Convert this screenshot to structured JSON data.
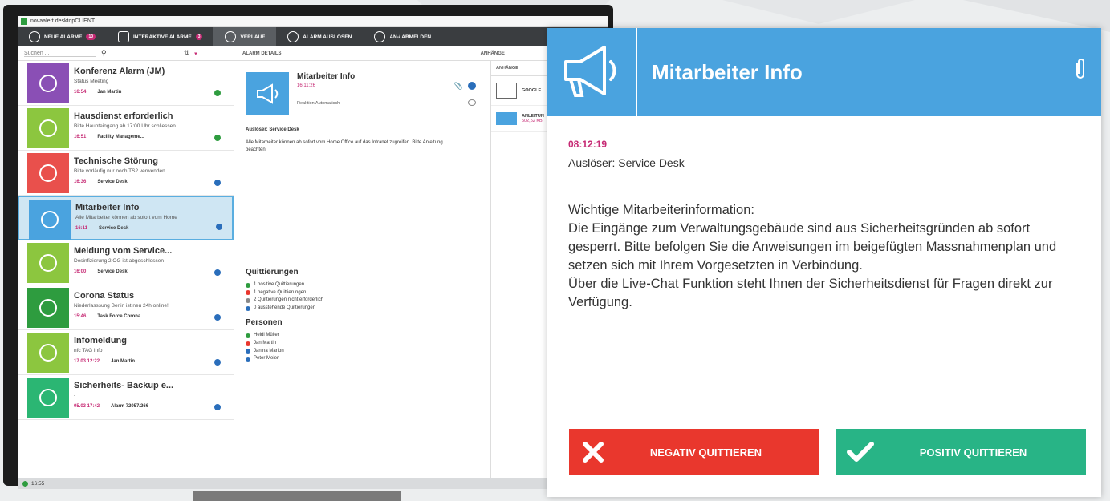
{
  "app": {
    "title": "novaalert desktopCLIENT"
  },
  "tabs": [
    {
      "label": "NEUE ALARME",
      "badge": "10"
    },
    {
      "label": "INTERAKTIVE ALARME",
      "badge": "3"
    },
    {
      "label": "VERLAUF"
    },
    {
      "label": "ALARM AUSLÖSEN"
    },
    {
      "label": "AN-/ ABMELDEN"
    }
  ],
  "search": {
    "placeholder": "Suchen ..."
  },
  "sections": {
    "details": "ALARM DETAILS",
    "attachments": "ANHÄNGE"
  },
  "alarms": [
    {
      "title": "Konferenz Alarm (JM)",
      "sub": "Status Meeting",
      "time": "16:54",
      "who": "Jan Martin",
      "color": "#8a4fb5",
      "status": "#2e9c3f"
    },
    {
      "title": "Hausdienst erforderlich",
      "sub": "Bitte Haupteingang ab 17:00 Uhr schliessen.",
      "time": "16:51",
      "who": "Facility Manageme...",
      "color": "#8cc63f",
      "status": "#2e9c3f"
    },
    {
      "title": "Technische Störung",
      "sub": "Bitte vorläufig nur noch TS2 verwenden.",
      "time": "16:36",
      "who": "Service Desk",
      "color": "#e9504c",
      "status": "#2a6ebb"
    },
    {
      "title": "Mitarbeiter Info",
      "sub": "Alle Mitarbeiter können ab sofort vom Home",
      "time": "16:11",
      "who": "Service Desk",
      "color": "#4aa3df",
      "status": "#2a6ebb"
    },
    {
      "title": "Meldung vom Service...",
      "sub": "Desinfizierung 2.OG ist abgeschlossen",
      "time": "16:00",
      "who": "Service Desk",
      "color": "#8cc63f",
      "status": "#2a6ebb"
    },
    {
      "title": "Corona Status",
      "sub": "Niederlasssung Berlin ist neu 24h online!",
      "time": "15:46",
      "who": "Task Force Corona",
      "color": "#2e9c3f",
      "status": "#2a6ebb"
    },
    {
      "title": "Infomeldung",
      "sub": "nfc TAG info",
      "time": "17.03 12:22",
      "who": "Jan Martin",
      "color": "#8cc63f",
      "status": "#2a6ebb"
    },
    {
      "title": "Sicherheits- Backup e...",
      "sub": "-",
      "time": "05.03 17:42",
      "who": "Alarm 72057/266",
      "color": "#2bb673",
      "status": "#2a6ebb"
    }
  ],
  "detail": {
    "title": "Mitarbeiter Info",
    "time": "16:11:26",
    "reaction": "Reaktion Automatisch",
    "trigger": "Auslöser: Service Desk",
    "text": "Alle Mitarbeiter können ab sofort vom Home Office auf das Intranet zugreifen. Bitte Anleitung beachten.",
    "ack_title": "Quittierungen",
    "acks": [
      {
        "label": "1 positive Quittierungen",
        "color": "#2e9c3f"
      },
      {
        "label": "1 negative Quittierungen",
        "color": "#e9372d"
      },
      {
        "label": "2 Quittierungen nicht erforderlich",
        "color": "#888888"
      },
      {
        "label": "0 ausstehende Quittierungen",
        "color": "#2a6ebb"
      }
    ],
    "persons_title": "Personen",
    "persons": [
      {
        "label": "Heidi Müller",
        "color": "#2e9c3f"
      },
      {
        "label": "Jan Martin",
        "color": "#e9372d"
      },
      {
        "label": "Janina Marlon",
        "color": "#2a6ebb"
      },
      {
        "label": "Peter Meier",
        "color": "#2a6ebb"
      }
    ]
  },
  "attachments": [
    {
      "name": "GOOGLE I",
      "size": ""
    },
    {
      "name": "ANLEITUN",
      "size": "502,52 KB"
    }
  ],
  "status": {
    "time": "16:55"
  },
  "popup": {
    "title": "Mitarbeiter Info",
    "time": "08:12:19",
    "trigger": "Auslöser: Service Desk",
    "message": "Wichtige Mitarbeiterinformation:\nDie Eingänge zum Verwaltungsgebäude sind aus Sicherheitsgründen ab sofort gesperrt. Bitte befolgen Sie die Anweisungen im beigefügten Massnahmenplan und setzen sich mit Ihrem Vorgesetzten in Verbindung.\nÜber die Live-Chat Funktion steht Ihnen der Sicherheitsdienst für Fragen direkt zur Verfügung.",
    "negative_label": "NEGATIV QUITTIEREN",
    "positive_label": "POSITIV QUITTIEREN",
    "header_color": "#4aa3df",
    "negative_color": "#e9372d",
    "positive_color": "#28b486"
  }
}
